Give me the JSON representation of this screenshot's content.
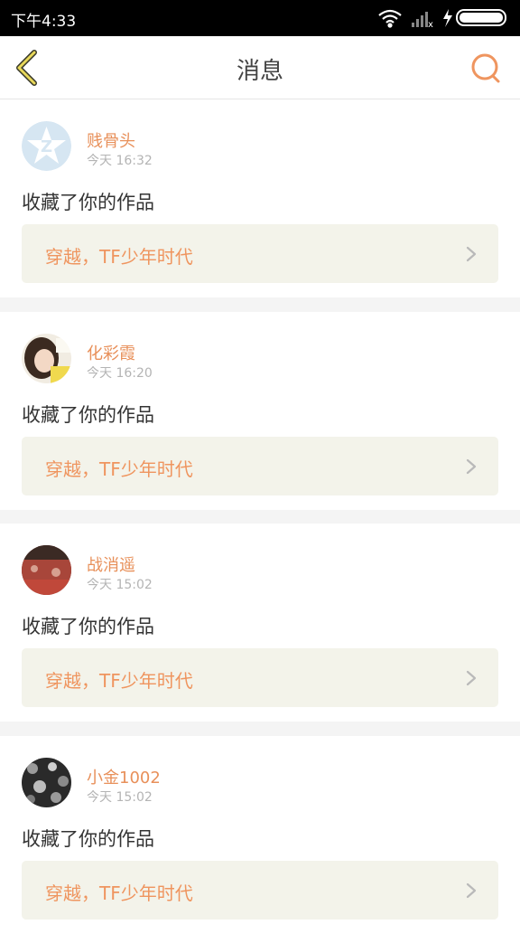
{
  "status_bar": {
    "time": "下午4:33"
  },
  "header": {
    "title": "消息"
  },
  "messages": [
    {
      "username": "贱骨头",
      "time": "今天 16:32",
      "action": "收藏了你的作品",
      "work_title": "穿越，TF少年时代"
    },
    {
      "username": "化彩霞",
      "time": "今天 16:20",
      "action": "收藏了你的作品",
      "work_title": "穿越，TF少年时代"
    },
    {
      "username": "战消遥",
      "time": "今天 15:02",
      "action": "收藏了你的作品",
      "work_title": "穿越，TF少年时代"
    },
    {
      "username": "小金1002",
      "time": "今天 15:02",
      "action": "收藏了你的作品",
      "work_title": "穿越，TF少年时代"
    }
  ],
  "colors": {
    "accent": "#ef955f",
    "back_arrow": "#e8d85a",
    "card_link_bg": "#f3f3ea"
  }
}
